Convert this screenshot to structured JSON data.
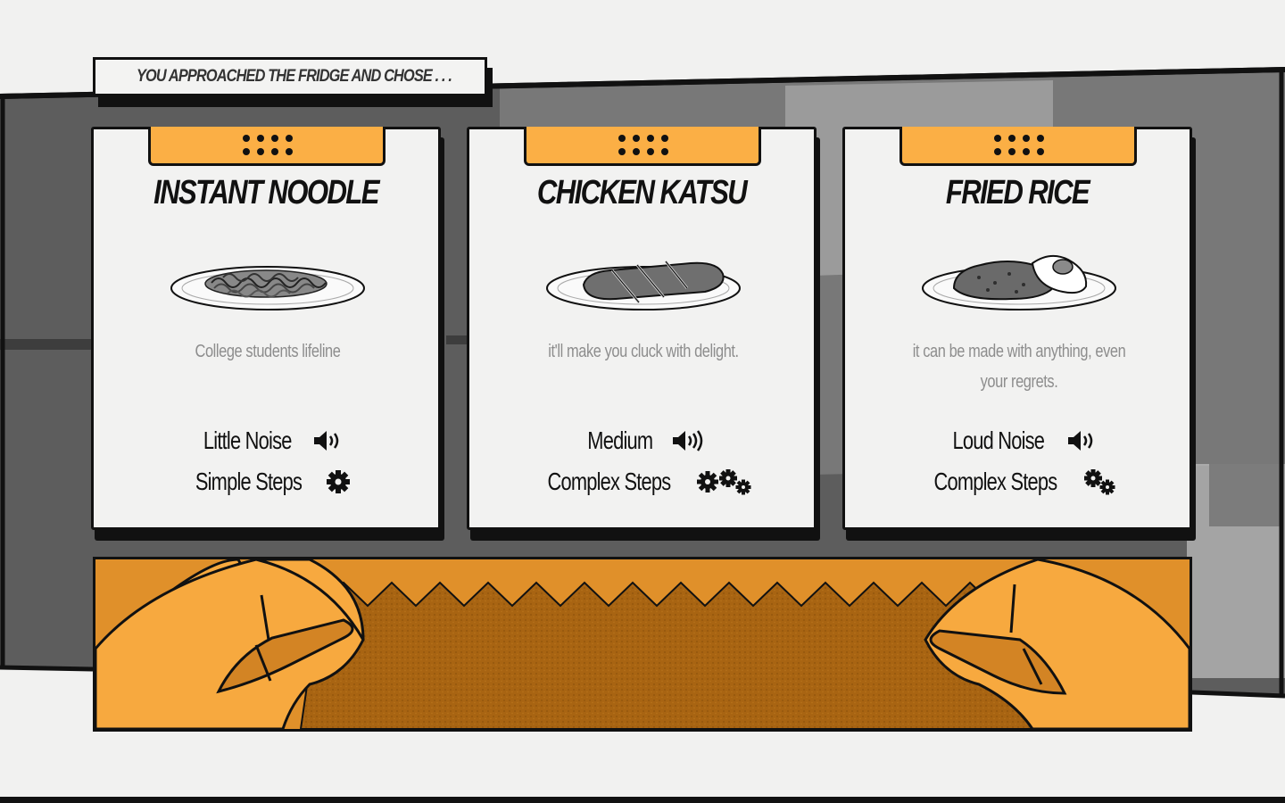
{
  "prompt": {
    "text": "You approached the fridge and chose . . ."
  },
  "cards": [
    {
      "title": "Instant Noodle",
      "image": "noodle-plate",
      "description": "College students lifeline",
      "noise_label": "Little Noise",
      "noise_icon": "speaker-low-icon",
      "steps_label": "Simple Steps",
      "steps_icon": "single-gear-icon"
    },
    {
      "title": "Chicken Katsu",
      "image": "katsu-plate",
      "description": "it'll make you cluck with delight.",
      "noise_label": "Medium",
      "noise_icon": "speaker-medium-icon",
      "steps_label": "Complex Steps",
      "steps_icon": "triple-gear-icon"
    },
    {
      "title": "Fried Rice",
      "image": "fried-rice-plate",
      "description": "it can be made with anything, even your regrets.",
      "noise_label": "Loud Noise",
      "noise_icon": "speaker-low-icon",
      "steps_label": "Complex Steps",
      "steps_icon": "double-gear-icon"
    }
  ],
  "colors": {
    "card_tab": "#fbaf45",
    "hand": "#f7a93f",
    "hand_panel": "#e0902a",
    "counter": "#a86412",
    "outline": "#111111"
  }
}
